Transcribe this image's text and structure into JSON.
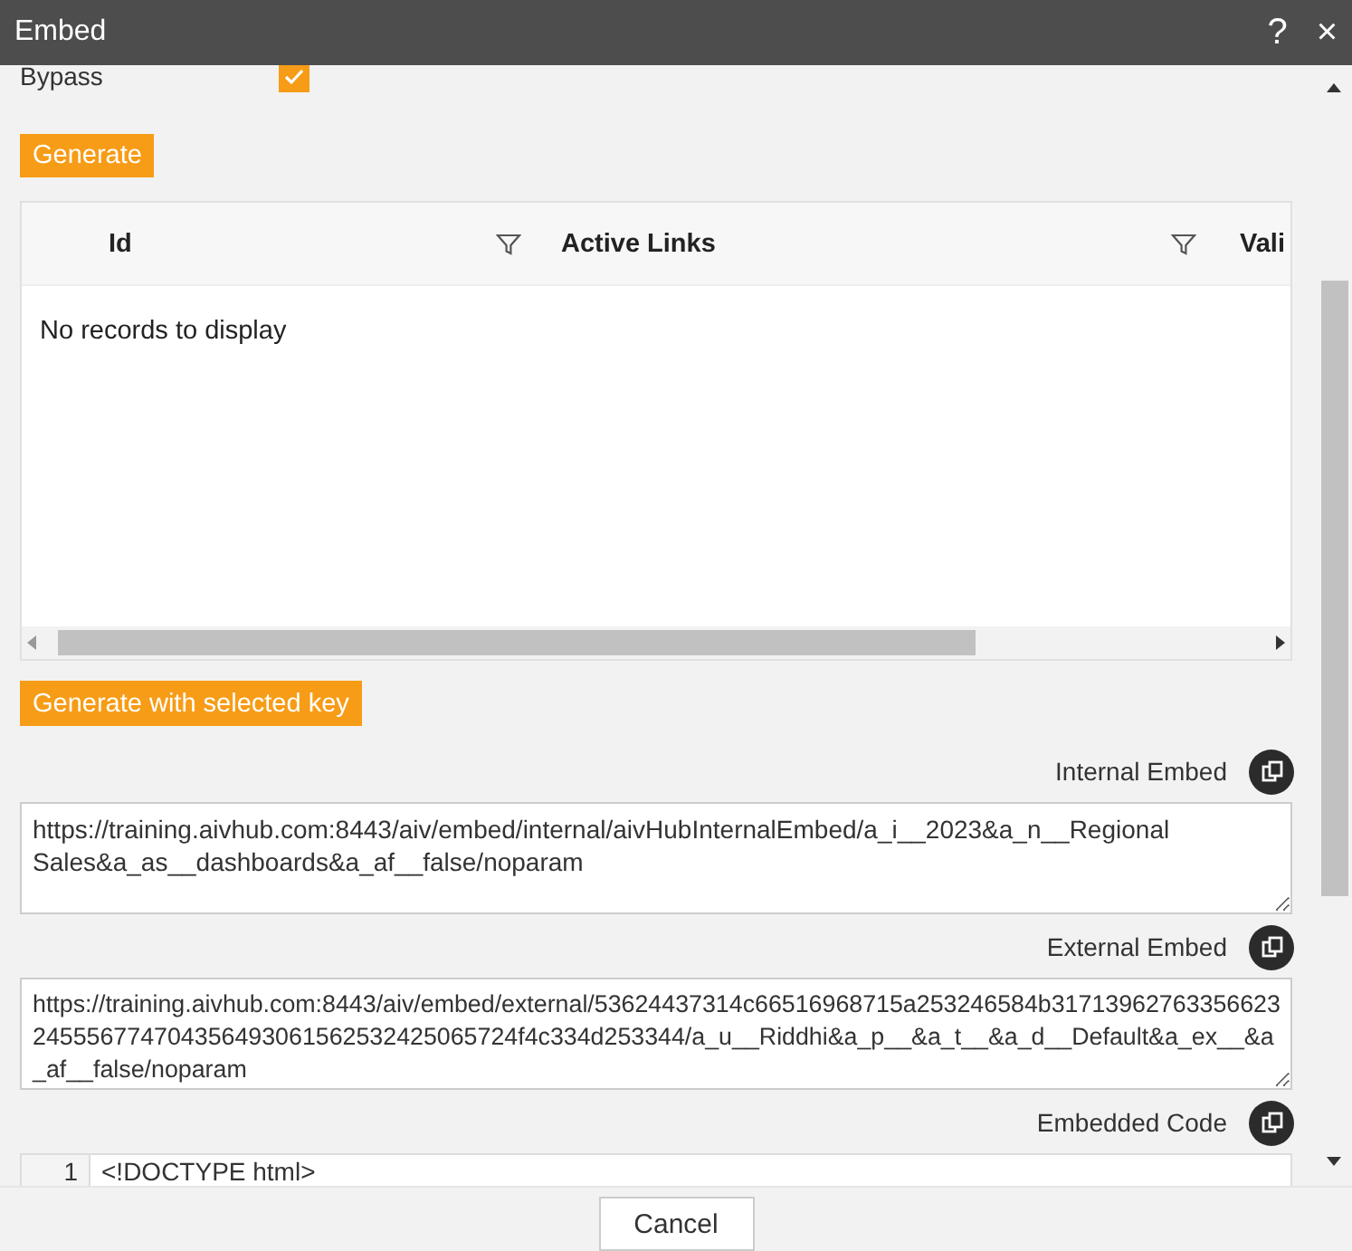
{
  "window": {
    "title": "Embed",
    "help": "?",
    "close": "×"
  },
  "bypass": {
    "label": "Bypass",
    "checked": true
  },
  "generate_button": "Generate",
  "table": {
    "columns": [
      {
        "label": "Id",
        "filter": true
      },
      {
        "label": "Active Links",
        "filter": true
      },
      {
        "label": "Vali",
        "filter": false
      }
    ],
    "empty_message": "No records to display"
  },
  "generate_with_key_button": "Generate with selected key",
  "fields": [
    {
      "kind": "text",
      "label": "Internal Embed",
      "value": "https://training.aivhub.com:8443/aiv/embed/internal/aivHubInternalEmbed/a_i__2023&a_n__Regional Sales&a_as__dashboards&a_af__false/noparam"
    },
    {
      "kind": "text",
      "label": "External Embed",
      "value": "https://training.aivhub.com:8443/aiv/embed/external/53624437314c66516968715a253246584b31713962763356623245556774704356493061562532425065724f4c334d253344/a_u__Riddhi&a_p__&a_t__&a_d__Default&a_ex__&a_af__false/noparam"
    },
    {
      "kind": "code",
      "label": "Embedded Code",
      "line_number": "1",
      "value": "<!DOCTYPE html>"
    }
  ],
  "cancel_button": "Cancel"
}
